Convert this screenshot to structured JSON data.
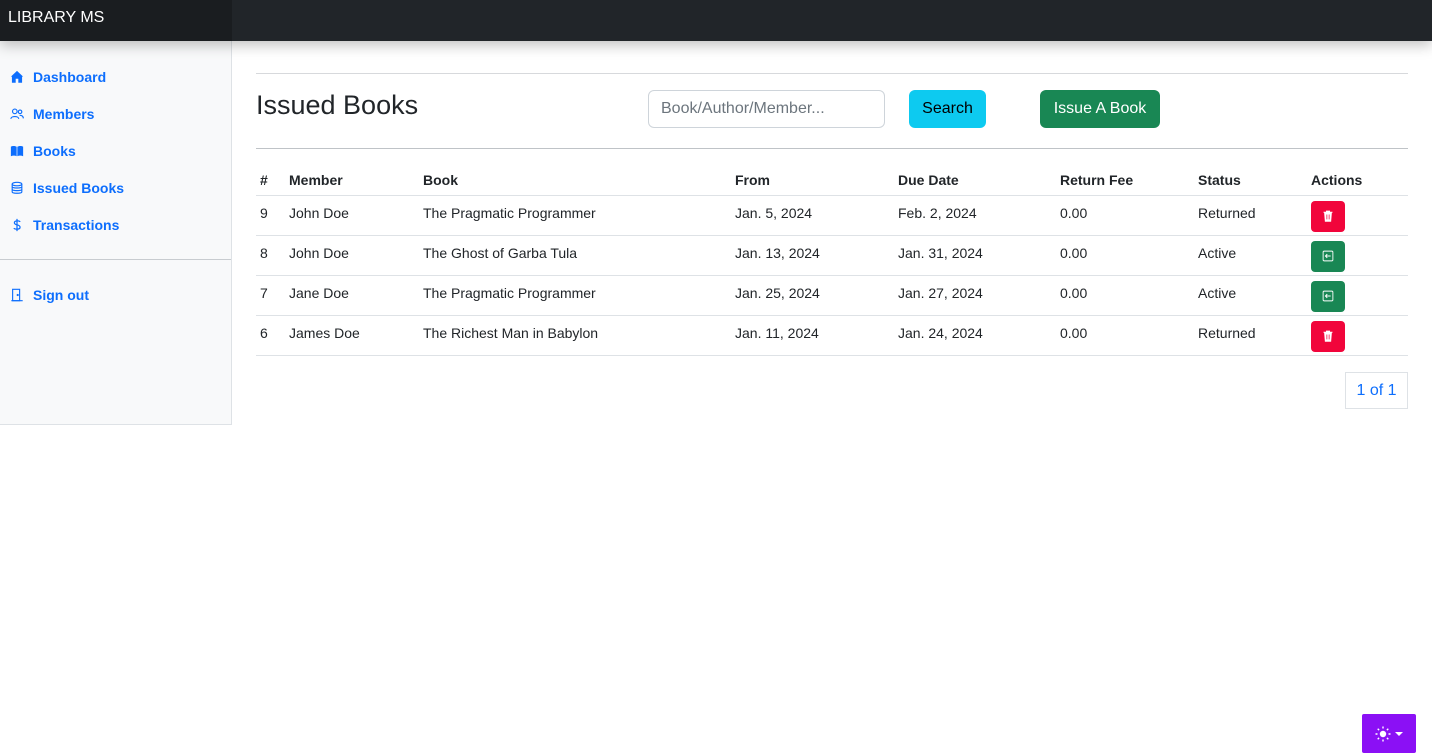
{
  "app": {
    "brand": "LIBRARY MS"
  },
  "sidebar": {
    "items": [
      {
        "label": "Dashboard",
        "icon": "house-icon"
      },
      {
        "label": "Members",
        "icon": "people-icon"
      },
      {
        "label": "Books",
        "icon": "book-icon"
      },
      {
        "label": "Issued Books",
        "icon": "database-icon"
      },
      {
        "label": "Transactions",
        "icon": "dollar-icon"
      }
    ],
    "signout": {
      "label": "Sign out",
      "icon": "door-icon"
    }
  },
  "main": {
    "title": "Issued Books",
    "search": {
      "placeholder": "Book/Author/Member...",
      "value": ""
    },
    "search_button": "Search",
    "issue_button": "Issue A Book"
  },
  "table": {
    "headers": [
      "#",
      "Member",
      "Book",
      "From",
      "Due Date",
      "Return Fee",
      "Status",
      "Actions"
    ],
    "rows": [
      {
        "id": "9",
        "member": "John Doe",
        "book": "The Pragmatic Programmer",
        "from": "Jan. 5, 2024",
        "due": "Feb. 2, 2024",
        "fee": "0.00",
        "status": "Returned",
        "action": "delete"
      },
      {
        "id": "8",
        "member": "John Doe",
        "book": "The Ghost of Garba Tula",
        "from": "Jan. 13, 2024",
        "due": "Jan. 31, 2024",
        "fee": "0.00",
        "status": "Active",
        "action": "return"
      },
      {
        "id": "7",
        "member": "Jane Doe",
        "book": "The Pragmatic Programmer",
        "from": "Jan. 25, 2024",
        "due": "Jan. 27, 2024",
        "fee": "0.00",
        "status": "Active",
        "action": "return"
      },
      {
        "id": "6",
        "member": "James Doe",
        "book": "The Richest Man in Babylon",
        "from": "Jan. 11, 2024",
        "due": "Jan. 24, 2024",
        "fee": "0.00",
        "status": "Returned",
        "action": "delete"
      }
    ]
  },
  "pagination": {
    "label": "1 of 1"
  },
  "colors": {
    "topbar": "#212529",
    "link": "#0d6efd",
    "search_button": "#0dcaf0",
    "issue_button": "#198754",
    "delete_button": "#f1053b",
    "return_button": "#198754",
    "theme_toggle": "#8b10f5"
  },
  "theme_toggle": {
    "icon": "sun-icon"
  }
}
